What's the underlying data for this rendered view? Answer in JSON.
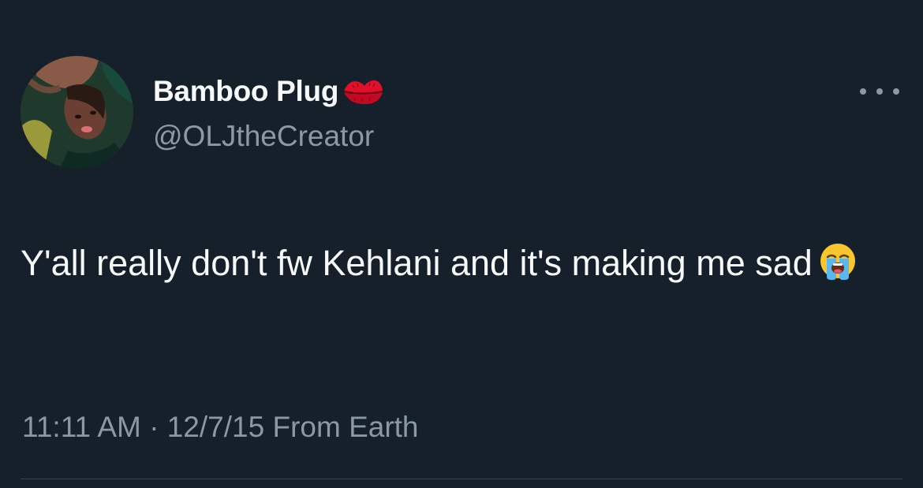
{
  "tweet": {
    "display_name": "Bamboo Plug",
    "handle": "@OLJtheCreator",
    "text": "Y'all really don't fw Kehlani and it's making me sad",
    "time": "11:11 AM",
    "separator": "·",
    "date_source": "12/7/15 From Earth"
  },
  "icons": {
    "name_emoji": "kiss-mark-icon",
    "text_emoji": "loudly-crying-face-icon",
    "more": "more-options-icon"
  },
  "colors": {
    "background": "#15202b",
    "primary_text": "#f7f9f9",
    "secondary_text": "#8b98a5",
    "divider": "#38444d"
  }
}
